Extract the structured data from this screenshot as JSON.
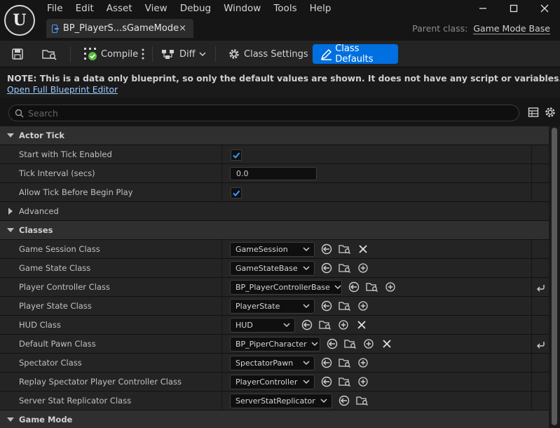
{
  "app": {
    "logo_glyph": "U",
    "menu": [
      "File",
      "Edit",
      "Asset",
      "View",
      "Debug",
      "Window",
      "Tools",
      "Help"
    ],
    "tab_title": "BP_PlayerS...sGameMode",
    "tab_close_glyph": "×",
    "parent_class_label": "Parent class:",
    "parent_class_value": "Game Mode Base"
  },
  "toolbar": {
    "compile_label": "Compile",
    "diff_label": "Diff",
    "class_settings_label": "Class Settings",
    "class_defaults_label": "Class Defaults"
  },
  "note": {
    "text": "NOTE: This is a data only blueprint, so only the default values are shown.  It does not have any script or variables.  If you want to add som",
    "link": "Open Full Blueprint Editor"
  },
  "search": {
    "placeholder": "Search"
  },
  "categories": {
    "actor_tick": "Actor Tick",
    "advanced": "Advanced",
    "classes": "Classes",
    "game_mode": "Game Mode"
  },
  "actor_tick": {
    "start_with_tick_label": "Start with Tick Enabled",
    "start_with_tick_checked": true,
    "tick_interval_label": "Tick Interval (secs)",
    "tick_interval_value": "0.0",
    "allow_tick_label": "Allow Tick Before Begin Play",
    "allow_tick_checked": true
  },
  "classes": [
    {
      "label": "Game Session Class",
      "value": "GameSession"
    },
    {
      "label": "Game State Class",
      "value": "GameStateBase"
    },
    {
      "label": "Player Controller Class",
      "value": "BP_PlayerControllerBase"
    },
    {
      "label": "Player State Class",
      "value": "PlayerState"
    },
    {
      "label": "HUD Class",
      "value": "HUD"
    },
    {
      "label": "Default Pawn Class",
      "value": "BP_PiperCharacter"
    },
    {
      "label": "Spectator Class",
      "value": "SpectatorPawn"
    },
    {
      "label": "Replay Spectator Player Controller Class",
      "value": "PlayerController"
    },
    {
      "label": "Server Stat Replicator Class",
      "value": "ServerStatReplicator"
    }
  ],
  "colors": {
    "accent": "#0070e0",
    "background": "#151515",
    "panel": "#242424",
    "category": "#2f2f2f"
  }
}
